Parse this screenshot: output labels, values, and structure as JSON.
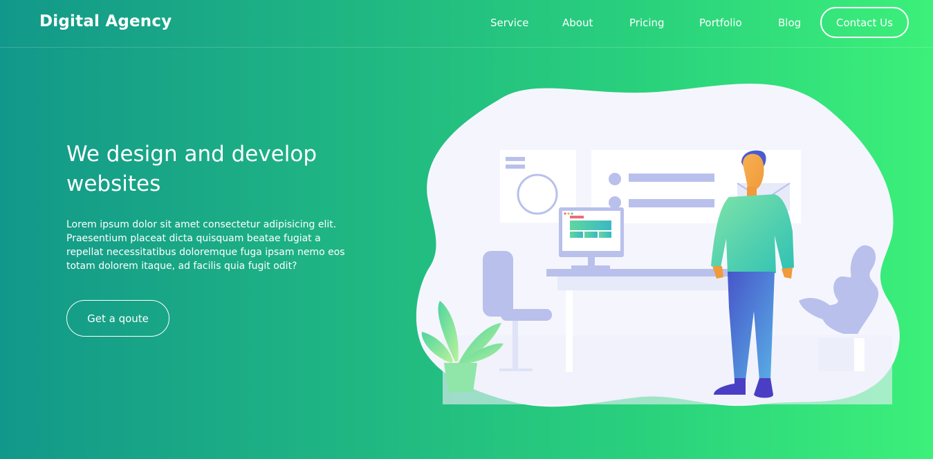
{
  "brand": {
    "name": "Digital Agency"
  },
  "nav": {
    "items": [
      {
        "label": "Service"
      },
      {
        "label": "About"
      },
      {
        "label": "Pricing"
      },
      {
        "label": "Portfolio"
      },
      {
        "label": "Blog"
      }
    ],
    "contact_label": "Contact Us"
  },
  "hero": {
    "title": "We design and develop websites",
    "text": "Lorem ipsum dolor sit amet consectetur adipisicing elit. Praesentium placeat dicta quisquam beatae fugiat a repellat necessitatibus doloremque fuga ipsam nemo eos totam dolorem itaque, ad facilis quia fugit odit?",
    "cta_label": "Get a qoute"
  },
  "colors": {
    "gradient_start": "#12988a",
    "gradient_end": "#3cf07a",
    "blob": "#f5f6fd",
    "lavender": "#b9c0ec"
  }
}
